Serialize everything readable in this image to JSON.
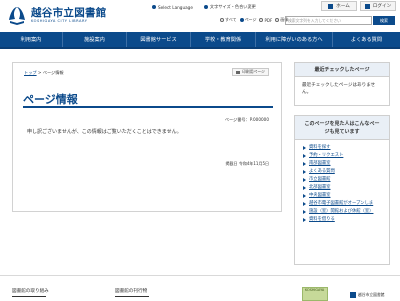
{
  "header": {
    "logo_title": "越谷市立図書館",
    "logo_sub": "KOSHIGAYA CITY LIBRARY",
    "select_language": "Select Language",
    "text_size_color": "文字サイズ・色合い変更",
    "home_button": "ホーム",
    "login_button": "ログイン"
  },
  "search": {
    "scope_options": [
      "すべて",
      "ページ",
      "PDF",
      "画像"
    ],
    "placeholder": "検索文字列を入力してください",
    "button_label": "検索"
  },
  "nav": {
    "items": [
      "利用案内",
      "施設案内",
      "図書館サービス",
      "学校・教育関係",
      "利用に障がいのある方へ",
      "よくある質問"
    ]
  },
  "main": {
    "breadcrumb_home": "トップ",
    "breadcrumb_sep": " > ",
    "breadcrumb_current": "ページ情報",
    "print_label": "印刷用ページ",
    "title": "ページ情報",
    "page_number": "ページ番号：P.000000",
    "message": "申し訳ございませんが、この情報はご覧いただくことはできません。",
    "updated": "掲載日 令和4年11月5日"
  },
  "sidebar": {
    "recent_title": "最近チェックしたページ",
    "recent_body": "最近チェックしたページはありません。",
    "related_title_line1": "このページを見た人はこんなペー",
    "related_title_line2": "ジも見ています",
    "related_links": [
      "資料を探す",
      "予約・リクエスト",
      "南部図書室",
      "よくある質問",
      "市立図書館",
      "北部図書室",
      "中央図書室",
      "越谷市電子図書館がオープンしま",
      "施設（室）開館および休館（室）",
      "資料を借りる"
    ]
  },
  "footer": {
    "col1": "図書館の取り組み",
    "col2": "図書館の刊行物",
    "banner_text": "KOSHIGAYA",
    "logo_text": "越谷市立図書館"
  },
  "colors": {
    "brand_blue": "#0b4a8b"
  }
}
